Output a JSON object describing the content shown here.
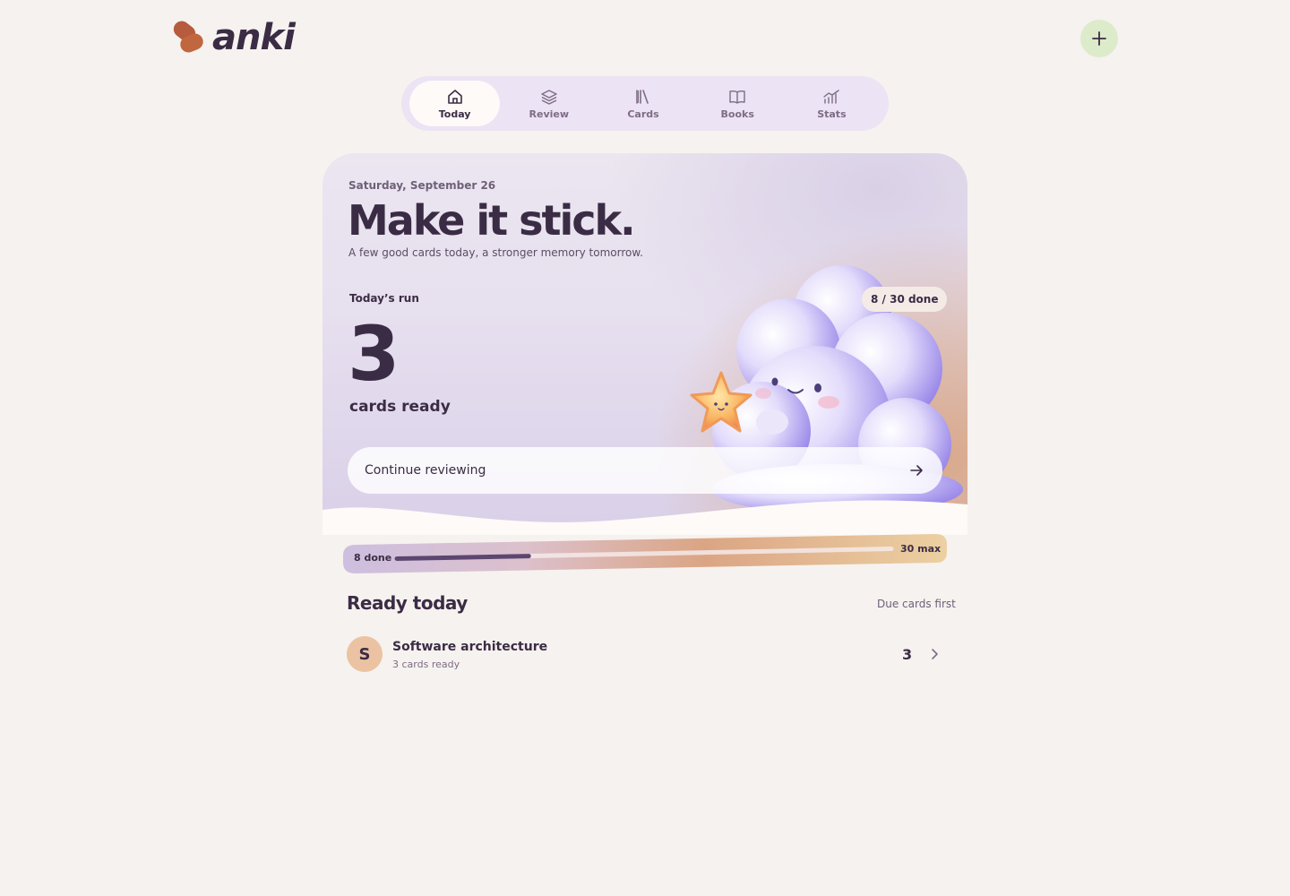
{
  "app": {
    "logo_text": "anki"
  },
  "header": {
    "add_button_icon": "plus-icon"
  },
  "nav": {
    "items": [
      {
        "label": "Today",
        "icon": "home-icon",
        "active": true
      },
      {
        "label": "Review",
        "icon": "layers-icon",
        "active": false
      },
      {
        "label": "Cards",
        "icon": "library-icon",
        "active": false
      },
      {
        "label": "Books",
        "icon": "book-icon",
        "active": false
      },
      {
        "label": "Stats",
        "icon": "chart-icon",
        "active": false
      }
    ]
  },
  "hero": {
    "date": "Saturday, September 26",
    "title": "Make it stick.",
    "subtitle": "A few good cards today, a stronger memory tomorrow.",
    "run_label": "Today’s run",
    "cards_ready_count": "3",
    "cards_ready_label": "cards ready",
    "done_badge": "8 / 30 done",
    "continue_label": "Continue reviewing"
  },
  "progress": {
    "done_label": "8 done",
    "max_label": "30 max",
    "done": 8,
    "max": 30
  },
  "ready": {
    "title": "Ready today",
    "sort_label": "Due cards first",
    "decks": [
      {
        "initial": "S",
        "name": "Software architecture",
        "subtitle": "3 cards ready",
        "count": "3"
      }
    ]
  },
  "colors": {
    "background": "#f6f2ef",
    "text": "#3b2c45",
    "accent_brand": "#b65b3d",
    "add_button": "#dcebc9",
    "nav_bg": "#ece3f4"
  }
}
